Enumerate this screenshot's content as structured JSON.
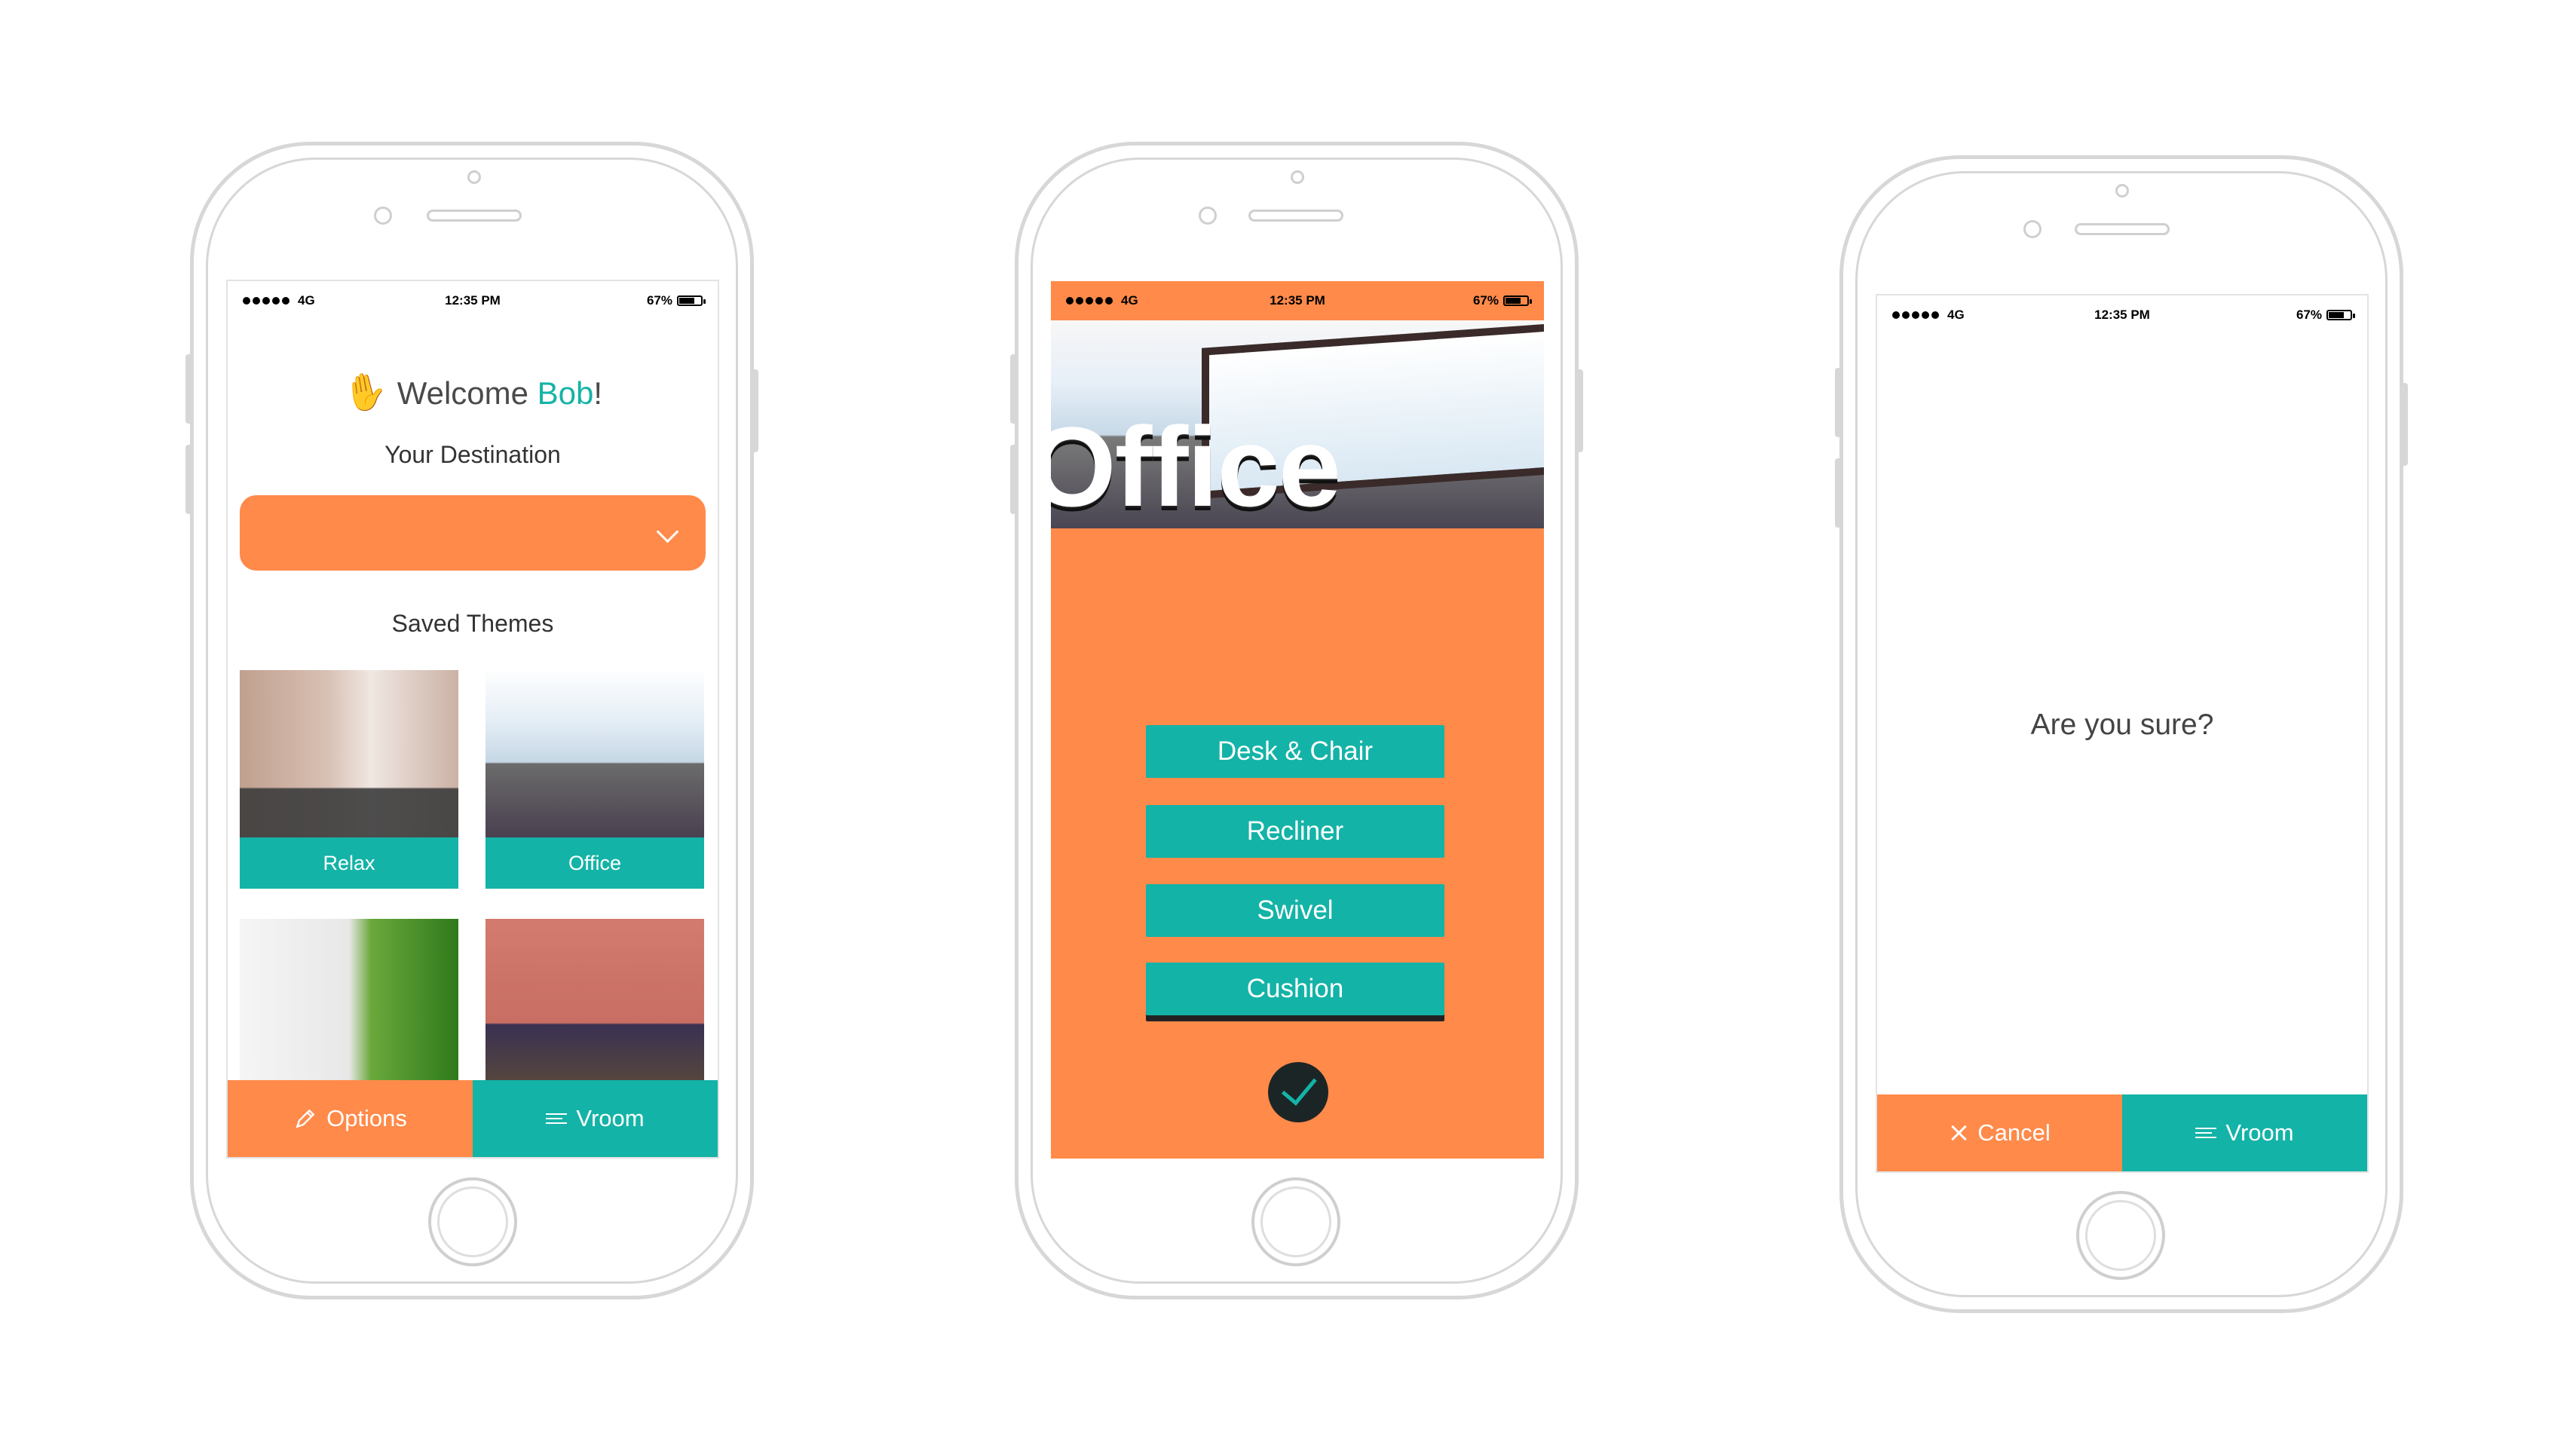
{
  "status": {
    "network": "4G",
    "time": "12:35 PM",
    "battery": "67%"
  },
  "screen1": {
    "welcome_prefix": "Welcome ",
    "user": "Bob",
    "welcome_suffix": "!",
    "destination_label": "Your Destination",
    "saved_label": "Saved Themes",
    "themes": [
      {
        "label": "Relax"
      },
      {
        "label": "Office"
      },
      {
        "label": ""
      },
      {
        "label": ""
      }
    ],
    "options_label": "Options",
    "vroom_label": "Vroom"
  },
  "screen2": {
    "title": "Office",
    "options": [
      "Desk & Chair",
      "Recliner",
      "Swivel",
      "Cushion"
    ]
  },
  "screen3": {
    "prompt": "Are you sure?",
    "cancel_label": "Cancel",
    "vroom_label": "Vroom"
  },
  "colors": {
    "orange": "#FF8A4A",
    "teal": "#14B3A7",
    "dark": "#1c2526"
  }
}
